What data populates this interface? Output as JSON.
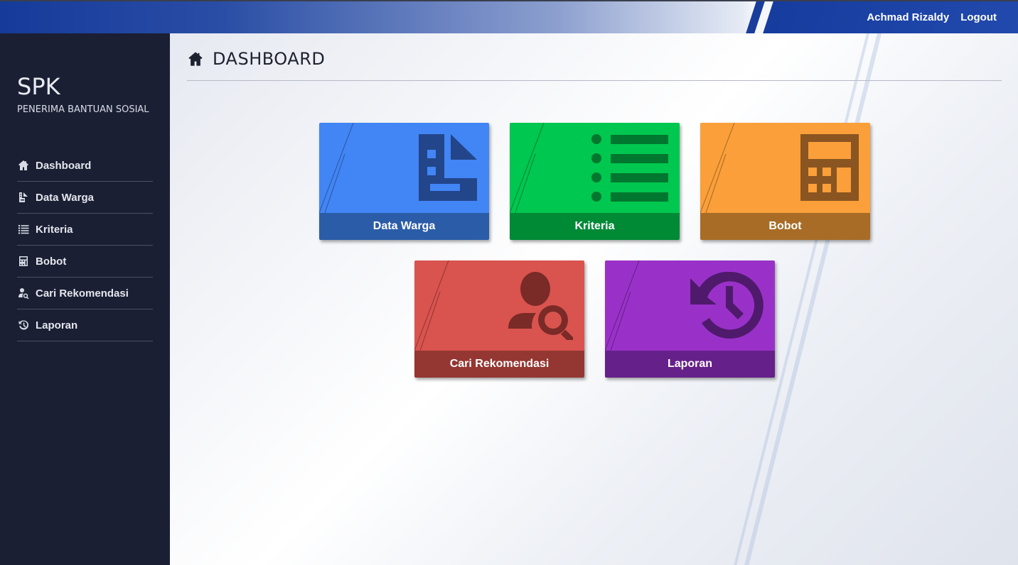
{
  "header": {
    "user_name": "Achmad Rizaldy",
    "logout_label": "Logout"
  },
  "sidebar": {
    "brand_title": "SPK",
    "brand_subtitle": "PENERIMA BANTUAN SOSIAL",
    "items": [
      {
        "label": "Dashboard",
        "icon": "home-icon"
      },
      {
        "label": "Data Warga",
        "icon": "document-icon"
      },
      {
        "label": "Kriteria",
        "icon": "list-icon"
      },
      {
        "label": "Bobot",
        "icon": "calculator-icon"
      },
      {
        "label": "Cari Rekomendasi",
        "icon": "user-search-icon"
      },
      {
        "label": "Laporan",
        "icon": "history-icon"
      }
    ]
  },
  "main": {
    "title": "DASHBOARD",
    "cards": [
      {
        "label": "Data Warga",
        "icon": "document-icon",
        "color": "#4285f4",
        "dark_color": "#2b5ca8",
        "icon_color": "#23458a"
      },
      {
        "label": "Kriteria",
        "icon": "list-icon",
        "color": "#00c74f",
        "dark_color": "#008a36",
        "icon_color": "#00772e"
      },
      {
        "label": "Bobot",
        "icon": "calculator-icon",
        "color": "#fa9f3a",
        "dark_color": "#a86c26",
        "icon_color": "#8a5520"
      },
      {
        "label": "Cari Rekomendasi",
        "icon": "user-search-icon",
        "color": "#d9534f",
        "dark_color": "#943632",
        "icon_color": "#7a2a27"
      },
      {
        "label": "Laporan",
        "icon": "history-icon",
        "color": "#9931c9",
        "dark_color": "#66208a",
        "icon_color": "#4f1a6b"
      }
    ]
  }
}
